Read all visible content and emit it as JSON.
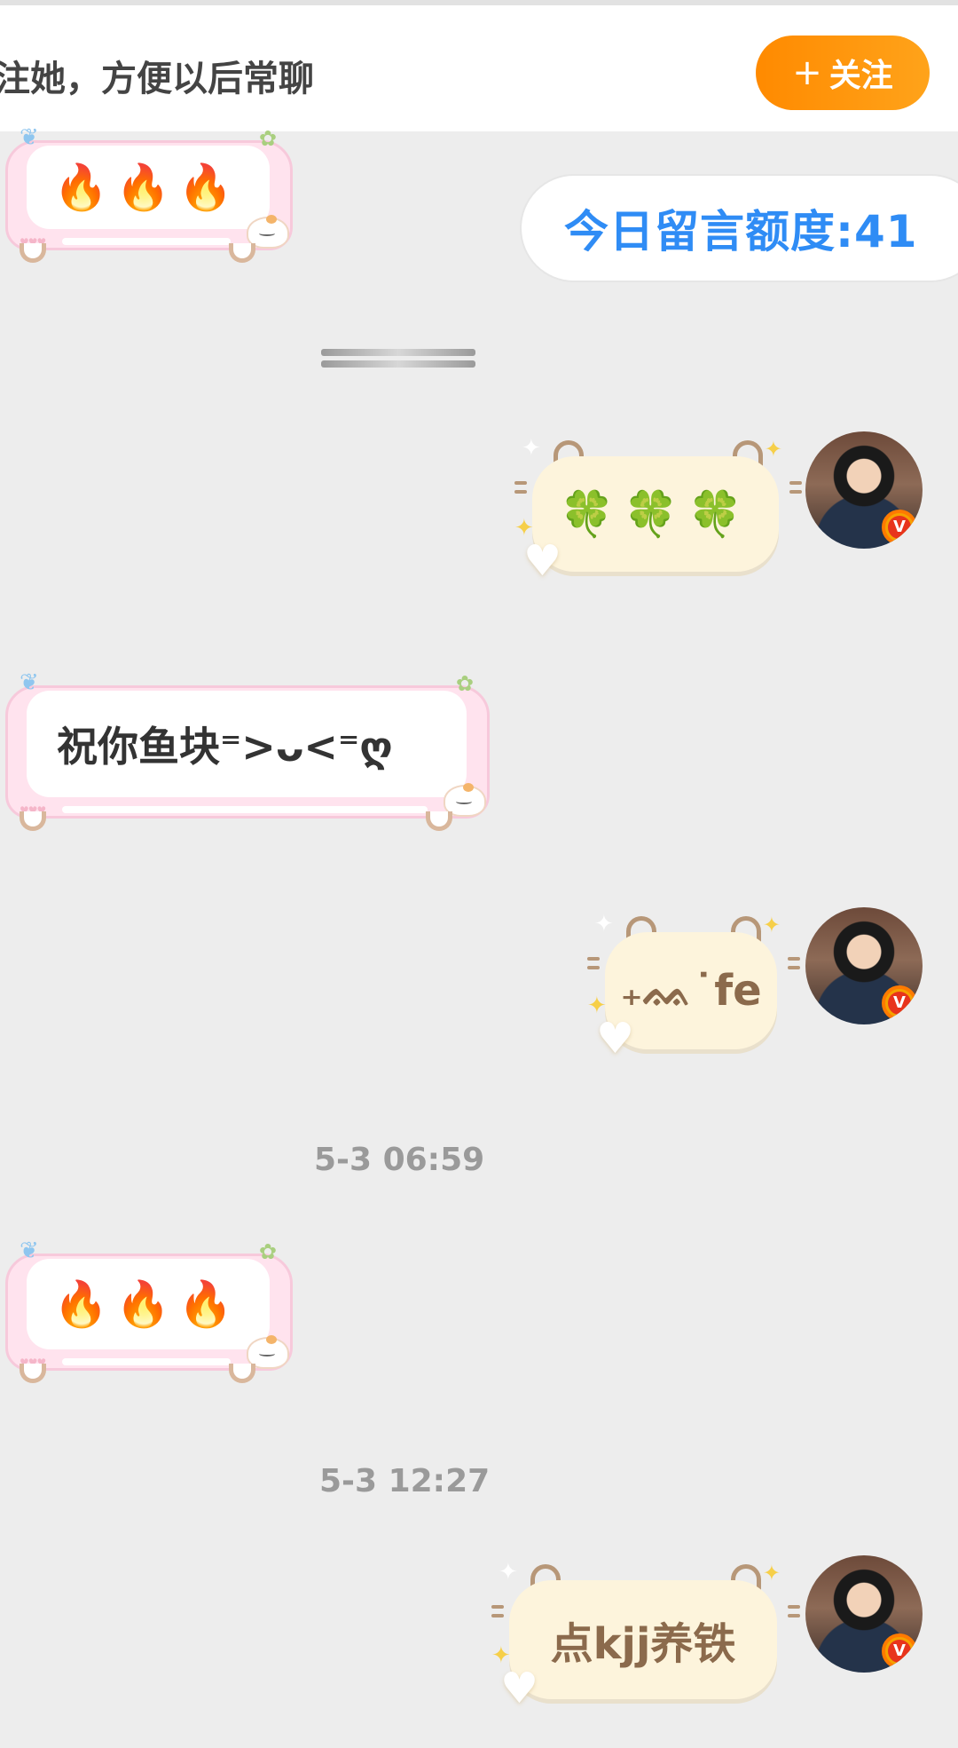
{
  "header": {
    "prompt_text": "注她，方便以后常聊",
    "follow_button_plus": "+",
    "follow_button_label": "关注"
  },
  "quota": {
    "label": "今日留言额度:41"
  },
  "messages": [
    {
      "direction": "incoming",
      "text": "🔥🔥🔥"
    },
    {
      "direction": "outgoing",
      "text": "🍀🍀🍀",
      "verified_badge": "V"
    },
    {
      "direction": "incoming",
      "text": "祝你鱼块⁼>ᴗ<⁼ღ"
    },
    {
      "direction": "outgoing",
      "text": "₊ᨐ˙fe",
      "verified_badge": "V"
    },
    {
      "timestamp": "5-3 06:59"
    },
    {
      "direction": "incoming",
      "text": "🔥🔥🔥"
    },
    {
      "timestamp": "5-3 12:27"
    },
    {
      "direction": "outgoing",
      "text": "点kjj养铁",
      "verified_badge": "V"
    }
  ],
  "colors": {
    "background": "#ededed",
    "follow_button": "#ff8a00",
    "quota_text": "#2f8cf5",
    "incoming_bubble": "#ffe3ee",
    "outgoing_bubble": "#fdf4dc",
    "outgoing_text": "#8b6a4c",
    "timestamp": "#9a9a9a"
  },
  "icons": {
    "follow_plus": "plus-icon",
    "avatar_badge": "verified-v-icon",
    "bubble_decor": [
      "butterfly-icon",
      "flower-icon",
      "cat-icon",
      "heart-icon",
      "sparkle-icon",
      "star-icon"
    ]
  }
}
